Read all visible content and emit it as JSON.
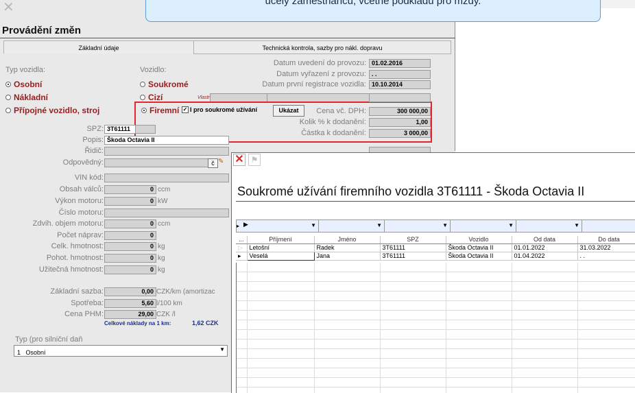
{
  "tooltip": {
    "text": "účely zaměstnanců, včetně podkladu pro mzdy."
  },
  "dialog": {
    "title": "Provádění změn",
    "tabs": [
      "Základní údaje",
      "Technická kontrola, sazby pro nákl. dopravu"
    ],
    "typ_vozidla": {
      "label": "Typ vozidla:",
      "options": [
        "Osobní",
        "Nákladní",
        "Přípojné vozidlo, stroj"
      ],
      "selected": "Osobní"
    },
    "vozidlo": {
      "label": "Vozidlo:",
      "options": [
        "Soukromé",
        "Cizí",
        "Firemní"
      ],
      "selected": "Firemní",
      "vlastnik_label": "Vlastník:"
    },
    "soukrome_uzivani": {
      "label": "I pro soukromé užívání",
      "checked": true,
      "button": "Ukázat"
    },
    "dates": [
      {
        "label": "Datum uvedení do provozu:",
        "value": "01.02.2016"
      },
      {
        "label": "Datum vyřazení z provozu:",
        "value": ". . "
      },
      {
        "label": "Datum první registrace vozidla:",
        "value": "10.10.2014"
      }
    ],
    "cena": [
      {
        "label": "Cena vč. DPH:",
        "value": "300 000,00"
      },
      {
        "label": "Kolik % k dodanění:",
        "value": "1,00"
      },
      {
        "label": "Částka k dodanění:",
        "value": "3 000,00"
      }
    ],
    "fields": [
      {
        "label": "SPZ:",
        "value": "3T61111"
      },
      {
        "label": "Popis:",
        "value": "Škoda Octavia II"
      },
      {
        "label": "Řidič:",
        "value": ""
      },
      {
        "label": "Odpovědný:",
        "value": ""
      },
      {
        "label": "VIN kód:",
        "value": ""
      },
      {
        "label": "Obsah válců:",
        "value": "0",
        "unit": "ccm"
      },
      {
        "label": "Výkon motoru:",
        "value": "0",
        "unit": "kW"
      },
      {
        "label": "Číslo motoru:",
        "value": ""
      },
      {
        "label": "Zdvih. objem motoru:",
        "value": "0",
        "unit": "ccm"
      },
      {
        "label": "Počet náprav:",
        "value": "0"
      },
      {
        "label": "Celk. hmotnost:",
        "value": "0",
        "unit": "kg"
      },
      {
        "label": "Pohot. hmotnost:",
        "value": "0",
        "unit": "kg"
      },
      {
        "label": "Užitečná hmotnost:",
        "value": "0",
        "unit": "kg"
      }
    ],
    "sazby": [
      {
        "label": "Základní sazba:",
        "value": "0,00",
        "unit": "CZK/km (amortizac"
      },
      {
        "label": "Spotřeba:",
        "value": "5,60",
        "unit": "l/100 km"
      },
      {
        "label": "Cena PHM:",
        "value": "29,00",
        "unit": "CZK /l"
      }
    ],
    "celkove_naklady": {
      "label": "Celkové náklady na 1 km:",
      "value": "1,62 CZK"
    },
    "typ_dan": {
      "label": "Typ (pro silniční daň",
      "value": "1   Osobní"
    },
    "odpovedny_btn": "č"
  },
  "popup": {
    "title": "Soukromé užívání firemního vozidla 3T61111 - Škoda Octavia II",
    "columns": [
      "Příjmení",
      "Jméno",
      "SPZ",
      "Vozidlo",
      "Od data",
      "Do data"
    ],
    "rows": [
      [
        "Letošní",
        "Radek",
        "3T61111",
        "Škoda Octavia II",
        "01.01.2022",
        "31.03.2022"
      ],
      [
        "Veselá",
        "Jana",
        "3T61111",
        "Škoda Octavia II",
        "01.04.2022",
        ". ."
      ]
    ]
  },
  "colors": {
    "highlight": "#e0272b",
    "tooltip_bg": "#dcefff",
    "tooltip_border": "#5a9bd5"
  }
}
